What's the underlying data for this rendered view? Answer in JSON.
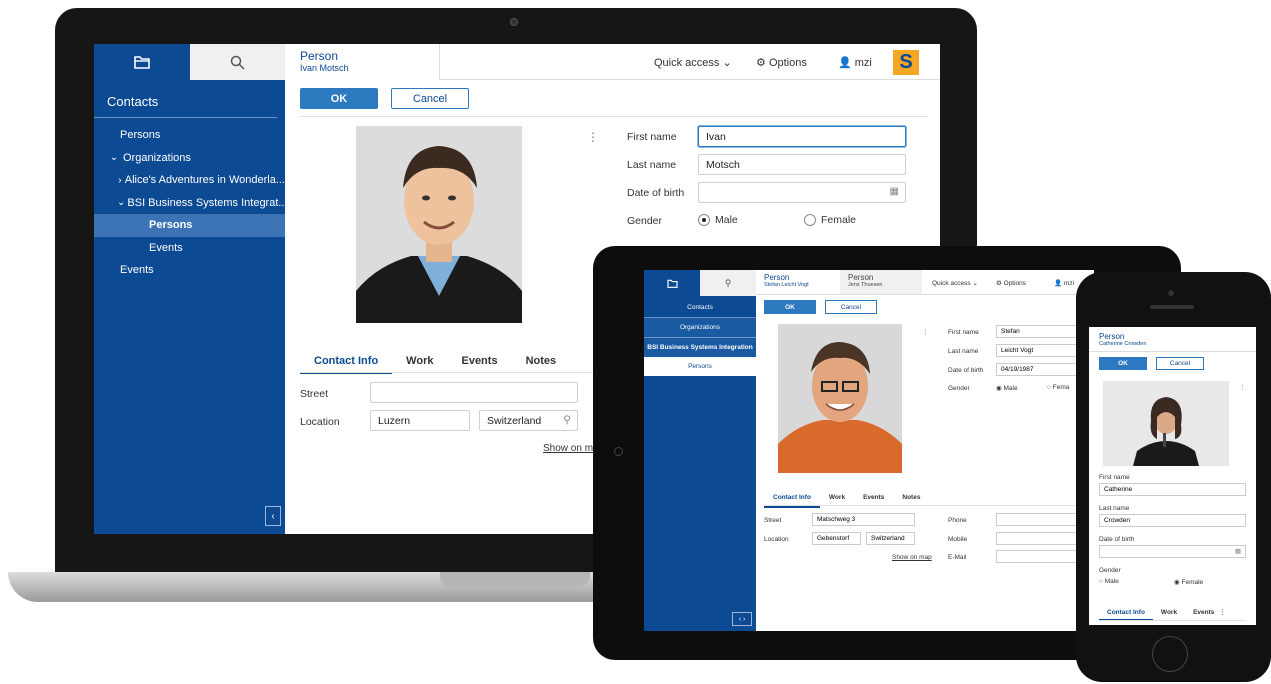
{
  "laptop": {
    "sidebar": {
      "tab_outline_icon": "folder-icon",
      "tab_search_icon": "search-icon",
      "title": "Contacts",
      "tree": [
        {
          "label": "Persons",
          "level": 0,
          "chevron": ""
        },
        {
          "label": "Organizations",
          "level": 0,
          "chevron": "expanded"
        },
        {
          "label": "Alice's Adventures in Wonderla...",
          "level": 1,
          "chevron": "collapsed"
        },
        {
          "label": "BSI Business Systems Integrat...",
          "level": 1,
          "chevron": "expanded"
        },
        {
          "label": "Persons",
          "level": 2,
          "chevron": "",
          "selected": true
        },
        {
          "label": "Events",
          "level": 2,
          "chevron": ""
        },
        {
          "label": "Events",
          "level": 0,
          "chevron": ""
        }
      ],
      "collapse_glyph": "‹"
    },
    "view_tab": {
      "title": "Person",
      "subtitle": "Ivan Motsch"
    },
    "header": {
      "quick_access": "Quick access",
      "options": "Options",
      "user": "mzi",
      "logo_letter": "S"
    },
    "buttons": {
      "ok": "OK",
      "cancel": "Cancel"
    },
    "form": {
      "first_name_label": "First name",
      "first_name": "Ivan",
      "last_name_label": "Last name",
      "last_name": "Motsch",
      "dob_label": "Date of birth",
      "dob": "",
      "gender_label": "Gender",
      "male": "Male",
      "female": "Female",
      "gender_selected": "Male"
    },
    "tabs": [
      "Contact Info",
      "Work",
      "Events",
      "Notes"
    ],
    "contact": {
      "street_label": "Street",
      "street": "",
      "location_label": "Location",
      "city": "Luzern",
      "country": "Switzerland",
      "map_link": "Show on ma"
    }
  },
  "tablet": {
    "sidebar": {
      "title": "Contacts",
      "org": "Organizations",
      "company": "BSI Business Systems Integration",
      "persons": "Persons"
    },
    "view_tabs": [
      {
        "title": "Person",
        "subtitle": "Stefan Leicht Vogt"
      },
      {
        "title": "Person",
        "subtitle": "Jens Thuesen"
      }
    ],
    "header": {
      "quick_access": "Quick access",
      "options": "Options",
      "user": "mzi"
    },
    "buttons": {
      "ok": "OK",
      "cancel": "Cancel"
    },
    "form": {
      "first_name_label": "First name",
      "first_name": "Stefan",
      "last_name_label": "Last name",
      "last_name": "Leicht Vogt",
      "dob_label": "Date of birth",
      "dob": "04/19/1987",
      "gender_label": "Gender",
      "male": "Male",
      "female": "Fema"
    },
    "tabs": [
      "Contact Info",
      "Work",
      "Events",
      "Notes"
    ],
    "contact": {
      "street_label": "Street",
      "street": "Matschweg 3",
      "location_label": "Location",
      "city": "Gebenstorf",
      "country": "Switzerland",
      "map_link": "Show on map",
      "phone_label": "Phone",
      "mobile_label": "Mobile",
      "email_label": "E-Mail"
    }
  },
  "phone": {
    "view_tab": {
      "title": "Person",
      "subtitle": "Catherine Crowden"
    },
    "buttons": {
      "ok": "OK",
      "cancel": "Cancel"
    },
    "form": {
      "first_name_label": "First name",
      "first_name": "Catherine",
      "last_name_label": "Last name",
      "last_name": "Crowden",
      "dob_label": "Date of birth",
      "dob": "",
      "gender_label": "Gender",
      "male": "Male",
      "female": "Female"
    },
    "tabs": [
      "Contact Info",
      "Work",
      "Events"
    ]
  }
}
